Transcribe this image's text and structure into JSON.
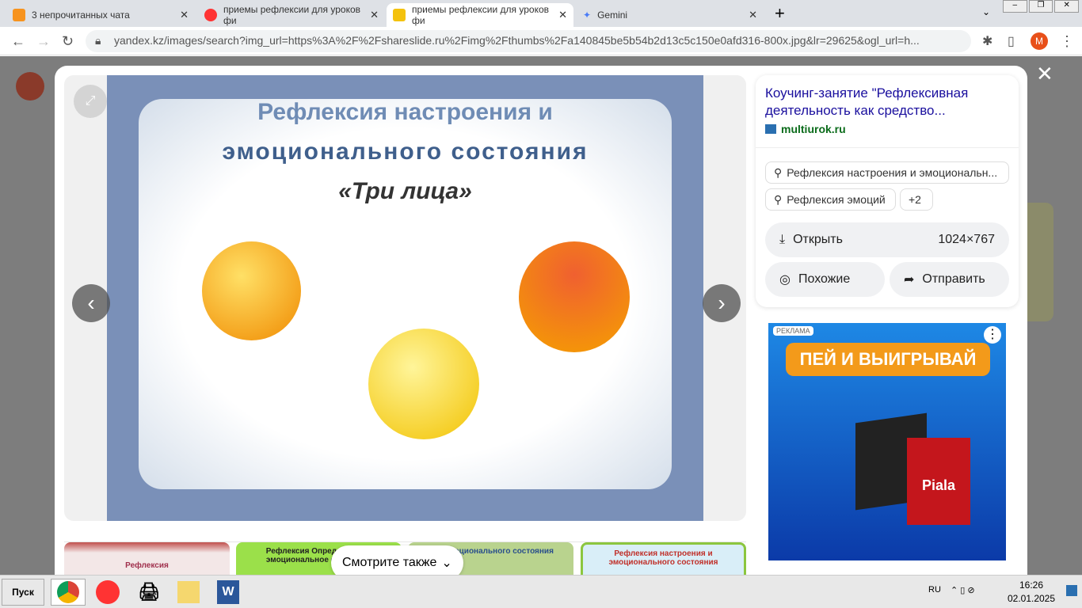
{
  "tabs": [
    {
      "title": "3 непрочитанных чата",
      "color": "#f7931e"
    },
    {
      "title": "приемы рефлексии для уроков фи",
      "color": "#f33"
    },
    {
      "title": "приемы рефлексии для уроков фи",
      "color": "#222"
    },
    {
      "title": "Gemini",
      "color": "#4a7cf7"
    }
  ],
  "address": {
    "url": "yandex.kz/images/search?img_url=https%3A%2F%2Fshareslide.ru%2Fimg%2Fthumbs%2Fa140845be5b54b2d13c5c150e0afd316-800x.jpg&lr=29625&ogl_url=h...",
    "profile": "M"
  },
  "image": {
    "line1": "Рефлексия настроения и",
    "line2": "эмоционального состояния",
    "line3": "«Три лица»"
  },
  "panel": {
    "title": "Коучинг-занятие \"Рефлексивная деятельность как средство...",
    "source": "multiurok.ru",
    "chips": [
      "Рефлексия настроения и эмоциональн...",
      "Рефлексия эмоций",
      "+2"
    ],
    "open": "Открыть",
    "size": "1024×767",
    "similar": "Похожие",
    "share": "Отправить"
  },
  "ad": {
    "label": "РЕКЛАМА",
    "headline": "ПЕЙ И ВЫИГРЫВАЙ",
    "brand": "Piala"
  },
  "thumbs": [
    "Рефлексия",
    "Рефлексия Определи своё эмоциональное состояние",
    "ния эмоционального состояния",
    "Рефлексия настроения и эмоционального состояния"
  ],
  "see_also": "Смотрите также",
  "taskbar": {
    "start": "Пуск",
    "lang": "RU",
    "time": "16:26",
    "date": "02.01.2025"
  }
}
